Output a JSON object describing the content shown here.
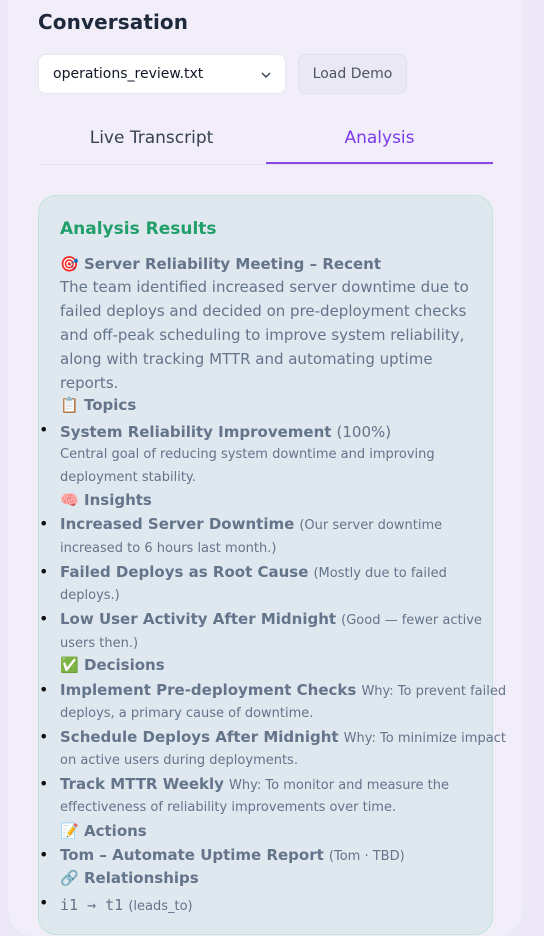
{
  "header": {
    "title": "Conversation"
  },
  "file_select": {
    "value": "operations_review.txt"
  },
  "load_button": {
    "label": "Load Demo"
  },
  "tabs": [
    {
      "label": "Live Transcript",
      "active": false
    },
    {
      "label": "Analysis",
      "active": true
    }
  ],
  "analysis": {
    "title": "Analysis Results",
    "meeting": {
      "icon": "🎯",
      "title": "Server Reliability Meeting – Recent",
      "summary_lines": [
        "The team identified increased server downtime due to",
        "failed deploys and decided on pre-deployment checks",
        "and off-peak scheduling to improve system reliability,",
        "along with tracking MTTR and automating uptime",
        "reports."
      ]
    },
    "topics": {
      "icon": "📋",
      "label": "Topics",
      "items": [
        {
          "title": "System Reliability Improvement",
          "pct": "(100%)",
          "desc_lines": [
            "Central goal of reducing system downtime and improving",
            "deployment stability."
          ]
        }
      ]
    },
    "insights": {
      "icon": "🧠",
      "label": "Insights",
      "items": [
        {
          "title": "Increased Server Downtime",
          "note1": "(Our server downtime",
          "note2": "increased to 6 hours last month.)"
        },
        {
          "title": "Failed Deploys as Root Cause",
          "note1": "(Mostly due to failed",
          "note2": "deploys.)"
        },
        {
          "title": "Low User Activity After Midnight",
          "note1": "(Good — fewer active",
          "note2": "users then.)"
        }
      ]
    },
    "decisions": {
      "icon": "✅",
      "label": "Decisions",
      "items": [
        {
          "title": "Implement Pre-deployment Checks",
          "note1": "Why: To prevent failed",
          "note2": "deploys, a primary cause of downtime."
        },
        {
          "title": "Schedule Deploys After Midnight",
          "note1": "Why: To minimize impact",
          "note2": "on active users during deployments."
        },
        {
          "title": "Track MTTR Weekly",
          "note1": "Why: To monitor and measure the",
          "note2": "effectiveness of reliability improvements over time."
        }
      ]
    },
    "actions": {
      "icon": "📝",
      "label": "Actions",
      "items": [
        {
          "title": "Tom – Automate Uptime Report",
          "meta": "(Tom · TBD)"
        }
      ]
    },
    "relationships": {
      "icon": "🔗",
      "label": "Relationships",
      "items": [
        {
          "expr": "i1 → t1",
          "type": "(leads_to)"
        }
      ]
    }
  }
}
